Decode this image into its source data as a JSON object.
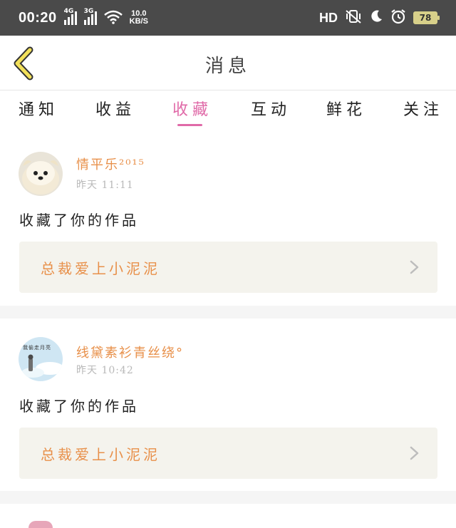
{
  "status_bar": {
    "time": "00:20",
    "network1": "4G",
    "network2": "3G",
    "speed_value": "10.0",
    "speed_unit": "KB/S",
    "hd_label": "HD",
    "battery": "78"
  },
  "header": {
    "title": "消息"
  },
  "tabs": [
    {
      "label": "通知"
    },
    {
      "label": "收益"
    },
    {
      "label": "收藏"
    },
    {
      "label": "互动"
    },
    {
      "label": "鲜花"
    },
    {
      "label": "关注"
    }
  ],
  "active_tab_index": 2,
  "messages": [
    {
      "username": "情平乐²⁰¹⁵",
      "time": "昨天 11:11",
      "action": "收藏了你的作品",
      "work_title": "总裁爱上小泥泥"
    },
    {
      "username": "线黛素衫青丝绕°",
      "time": "昨天 10:42",
      "action": "收藏了你的作品",
      "work_title": "总裁爱上小泥泥",
      "avatar_text": "我偷走月亮"
    }
  ],
  "colors": {
    "accent_pink": "#e06aa8",
    "accent_orange": "#e8904a",
    "status_bar": "#4a4a4a",
    "card_box": "#f4f3ed",
    "back_arrow": "#f2e05a"
  }
}
